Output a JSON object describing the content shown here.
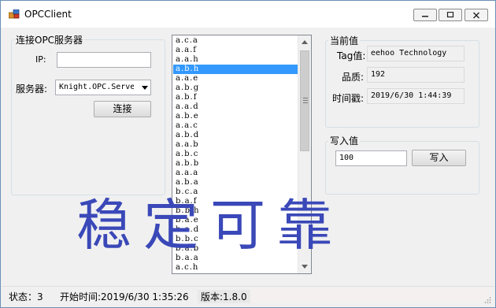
{
  "window": {
    "title": "OPCClient",
    "icon": "app-icon"
  },
  "connect_group": {
    "title": "连接OPC服务器",
    "ip_label": "IP:",
    "ip_value": "",
    "server_label": "服务器:",
    "server_value": "Knight.OPC.Server",
    "connect_button": "连接"
  },
  "list": {
    "items": [
      "a.c.a",
      "a.a.f",
      "a.a.h",
      "a.b.h",
      "a.a.e",
      "a.b.g",
      "a.b.f",
      "a.a.d",
      "a.b.e",
      "a.a.c",
      "a.b.d",
      "a.a.b",
      "a.b.c",
      "a.b.b",
      "a.a.a",
      "a.b.a",
      "b.c.a",
      "b.a.f",
      "b.b.h",
      "b.a.e",
      "b.a.d",
      "b.b.c",
      "b.a.b",
      "b.a.a",
      "a.c.h"
    ],
    "selected_index": 3
  },
  "current_group": {
    "title": "当前值",
    "tag_label": "Tag值:",
    "tag_value": "eehoo Technology",
    "quality_label": "品质:",
    "quality_value": "192",
    "timestamp_label": "时间戳:",
    "timestamp_value": "2019/6/30 1:44:39"
  },
  "write_group": {
    "title": "写入值",
    "value": "100",
    "write_button": "写入"
  },
  "watermark": "稳定可靠",
  "status": {
    "state": "状态：3",
    "start_time": "开始时间:2019/6/30 1:35:26",
    "version": "版本:1.8.0"
  },
  "colors": {
    "selection": "#3399ff",
    "watermark": "#3a48b8",
    "window_bg": "#f0f0f0"
  }
}
